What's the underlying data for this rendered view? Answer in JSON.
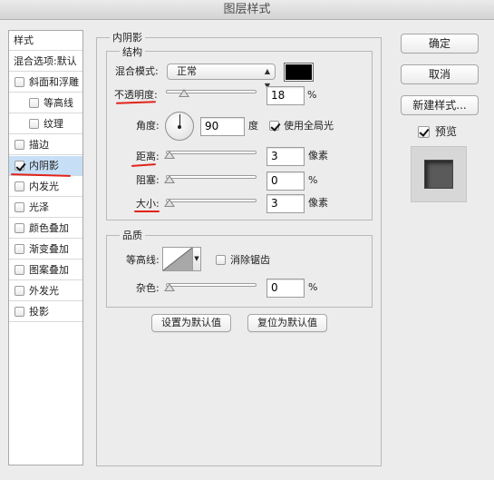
{
  "window": {
    "title": "图层样式"
  },
  "sidebar": {
    "header": "样式",
    "blend_options": "混合选项:默认",
    "items": [
      {
        "label": "斜面和浮雕",
        "checked": false
      },
      {
        "label": "等高线",
        "checked": false
      },
      {
        "label": "纹理",
        "checked": false
      },
      {
        "label": "描边",
        "checked": false
      },
      {
        "label": "内阴影",
        "checked": true
      },
      {
        "label": "内发光",
        "checked": false
      },
      {
        "label": "光泽",
        "checked": false
      },
      {
        "label": "颜色叠加",
        "checked": false
      },
      {
        "label": "渐变叠加",
        "checked": false
      },
      {
        "label": "图案叠加",
        "checked": false
      },
      {
        "label": "外发光",
        "checked": false
      },
      {
        "label": "投影",
        "checked": false
      }
    ]
  },
  "inner_shadow": {
    "title": "内阴影",
    "structure": {
      "title": "结构",
      "blend_mode_label": "混合模式:",
      "blend_mode_value": "正常",
      "blend_color": "#000000",
      "opacity_label": "不透明度:",
      "opacity_value": "18",
      "opacity_unit": "%",
      "angle_label": "角度:",
      "angle_value": "90",
      "angle_unit": "度",
      "global_light_label": "使用全局光",
      "global_light_checked": true,
      "distance_label": "距离:",
      "distance_value": "3",
      "distance_unit": "像素",
      "choke_label": "阻塞:",
      "choke_value": "0",
      "choke_unit": "%",
      "size_label": "大小:",
      "size_value": "3",
      "size_unit": "像素"
    },
    "quality": {
      "title": "品质",
      "contour_label": "等高线:",
      "antialias_label": "消除锯齿",
      "antialias_checked": false,
      "noise_label": "杂色:",
      "noise_value": "0",
      "noise_unit": "%"
    },
    "make_default_label": "设置为默认值",
    "reset_default_label": "复位为默认值"
  },
  "actions": {
    "ok_label": "确定",
    "cancel_label": "取消",
    "new_style_label": "新建样式...",
    "preview_label": "预览",
    "preview_checked": true
  },
  "annotation_color": "#e2231a"
}
